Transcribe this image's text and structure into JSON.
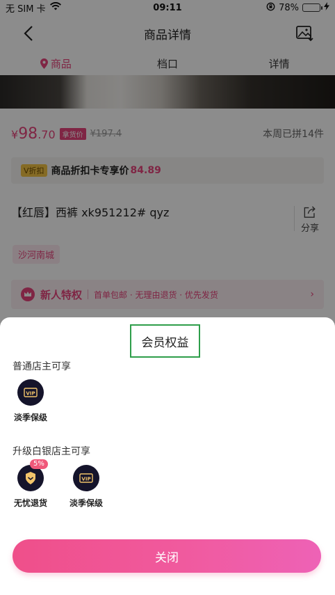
{
  "status_bar": {
    "carrier": "无 SIM 卡",
    "time": "09:11",
    "battery_percent": "78%",
    "battery_level": 0.78
  },
  "nav": {
    "title": "商品详情"
  },
  "tabs": [
    {
      "label": "商品",
      "active": true
    },
    {
      "label": "档口",
      "active": false
    },
    {
      "label": "详情",
      "active": false
    }
  ],
  "product": {
    "currency": "¥",
    "price_int": "98",
    "price_dec": ".70",
    "price_tag": "拿货价",
    "original_price": "¥197.4",
    "weekly_sales": "本周已拼14件",
    "discount_badge": "V折扣",
    "discount_text": "商品折扣卡专享价",
    "discount_price": "84.89",
    "title": "【红唇】西裤  xk951212#  qyz",
    "share_label": "分享",
    "market": "沙河南城",
    "privilege_title": "新人特权",
    "privilege_desc": "首单包邮 · 无理由退货 · 优先发货"
  },
  "sheet": {
    "title": "会员权益",
    "section_normal": "普通店主可享",
    "normal_benefits": [
      {
        "label": "淡季保级",
        "icon": "vip-icon"
      }
    ],
    "section_silver": "升级白银店主可享",
    "silver_benefits": [
      {
        "label": "无忧退货",
        "icon": "shield-icon",
        "badge": "5%"
      },
      {
        "label": "淡季保级",
        "icon": "vip-icon"
      }
    ],
    "close_label": "关闭"
  },
  "colors": {
    "accent": "#e8447c",
    "icon_bg": "#15142b",
    "highlight_border": "#2e9e4a"
  }
}
